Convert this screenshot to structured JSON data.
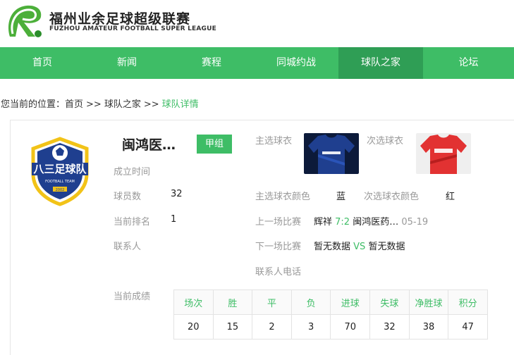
{
  "header": {
    "brand_cn": "福州业余足球超级联赛",
    "brand_en": "FUZHOU AMATEUR FOOTBALL SUPER LEAGUE"
  },
  "nav": [
    {
      "label": "首页"
    },
    {
      "label": "新闻"
    },
    {
      "label": "赛程"
    },
    {
      "label": "同城约战"
    },
    {
      "label": "球队之家",
      "active": true
    },
    {
      "label": "论坛"
    }
  ],
  "breadcrumb": {
    "prefix": "您当前的位置：",
    "home": "首页",
    "sep": ">>",
    "section": "球队之家",
    "current": "球队详情"
  },
  "team": {
    "logo_text": "八三足球队",
    "logo_sub": "FOOTBALL TEAM",
    "logo_year": "2002",
    "name": "闽鸿医…",
    "division": "甲组",
    "founded_label": "成立时间",
    "founded_value": "",
    "players_label": "球员数",
    "players_value": "32",
    "rank_label": "当前排名",
    "rank_value": "1",
    "contact_label": "联系人",
    "contact_value": "",
    "home_kit_label": "主选球衣",
    "away_kit_label": "次选球衣",
    "home_color_label": "主选球衣颜色",
    "home_color_value": "蓝",
    "away_color_label": "次选球衣颜色",
    "away_color_value": "红",
    "last_match_label": "上一场比赛",
    "last_match": {
      "home": "辉祥",
      "score": "7:2",
      "away": "闽鸿医药…",
      "date": "05-19"
    },
    "next_match_label": "下一场比赛",
    "next_match": {
      "home": "暂无数据",
      "vs": "VS",
      "away": "暂无数据"
    },
    "phone_label": "联系人电话",
    "record_label": "当前成绩"
  },
  "stats": {
    "headers": [
      "场次",
      "胜",
      "平",
      "负",
      "进球",
      "失球",
      "净胜球",
      "积分"
    ],
    "values": [
      "20",
      "15",
      "2",
      "3",
      "70",
      "32",
      "38",
      "47"
    ]
  },
  "colors": {
    "accent": "#3ebd66",
    "accent_dark": "#2f9e55",
    "home_kit": "#1f3f8f",
    "away_kit": "#e23232"
  }
}
